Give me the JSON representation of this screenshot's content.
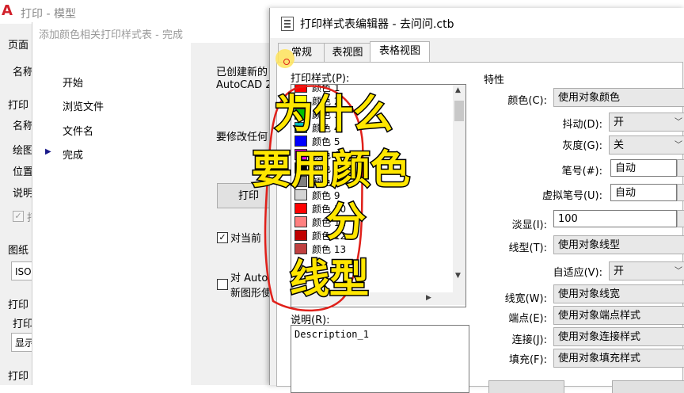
{
  "print_window": {
    "logo": "A",
    "title": "打印 - 模型",
    "labels": [
      "页面",
      "名称",
      "打印",
      "名称",
      "绘图",
      "位置",
      "说明",
      "图纸",
      "打印",
      "打印",
      "打印"
    ],
    "checkbox_label": "打",
    "select_1": "ISO",
    "select_2": "显示"
  },
  "wizard": {
    "title": "添加颜色相关打印样式表 - 完成",
    "steps": [
      "开始",
      "浏览文件",
      "文件名",
      "完成"
    ],
    "current_step_marker": "▶",
    "line1": "已创建新的",
    "line2": "AutoCAD 2",
    "prompt": "要修改任何",
    "button": "打印",
    "check1": "对当前",
    "check2_line1": "对 Auto",
    "check2_line2": "新图形使"
  },
  "editor": {
    "title": "打印样式表编辑器 - 去问问.ctb",
    "tabs": [
      "常规",
      "表视图",
      "表格视图"
    ],
    "active_tab": "表格视图",
    "styles_label": "打印样式(P):",
    "styles": [
      {
        "name": "颜色 1",
        "color": "#ff0000"
      },
      {
        "name": "颜色 2",
        "color": "#ffff00"
      },
      {
        "name": "颜色 3",
        "color": "#00c000"
      },
      {
        "name": "颜色 4",
        "color": "#00c0c0"
      },
      {
        "name": "颜色 5",
        "color": "#0000ff"
      },
      {
        "name": "颜色 6",
        "color": "#ff00ff"
      },
      {
        "name": "颜色 7",
        "color": "#000000"
      },
      {
        "name": "颜色 8",
        "color": "#808080"
      },
      {
        "name": "颜色 9",
        "color": "#d4d4d4"
      },
      {
        "name": "颜色 10",
        "color": "#ff0000"
      },
      {
        "name": "颜色 11",
        "color": "#ff8080"
      },
      {
        "name": "颜色 12",
        "color": "#c00000"
      },
      {
        "name": "颜色 13",
        "color": "#c04040"
      }
    ],
    "description_label": "说明(R):",
    "description_value": "Description_1",
    "properties_label": "特性",
    "props": {
      "color_label": "颜色(C):",
      "color_value": "使用对象颜色",
      "dither_label": "抖动(D):",
      "dither_value": "开",
      "grayscale_label": "灰度(G):",
      "grayscale_value": "关",
      "pen_label": "笔号(#):",
      "pen_value": "自动",
      "vpen_label": "虚拟笔号(U):",
      "vpen_value": "自动",
      "screening_label": "淡显(I):",
      "screening_value": "100",
      "linetype_label": "线型(T):",
      "linetype_value": "使用对象线型",
      "adaptive_label": "自适应(V):",
      "adaptive_value": "开",
      "lineweight_label": "线宽(W):",
      "lineweight_value": "使用对象线宽",
      "endstyle_label": "端点(E):",
      "endstyle_value": "使用对象端点样式",
      "joinstyle_label": "连接(J):",
      "joinstyle_value": "使用对象连接样式",
      "fill_label": "填充(F):",
      "fill_value": "使用对象填充样式"
    }
  },
  "overlay": {
    "line1": "为什么",
    "line2": "要用颜色",
    "line3": "分",
    "line4": "线型"
  },
  "colors": {
    "annotation_red": "#e0201a",
    "overlay_yellow": "#ffe600",
    "cursor_yellow": "#ffe45c"
  }
}
